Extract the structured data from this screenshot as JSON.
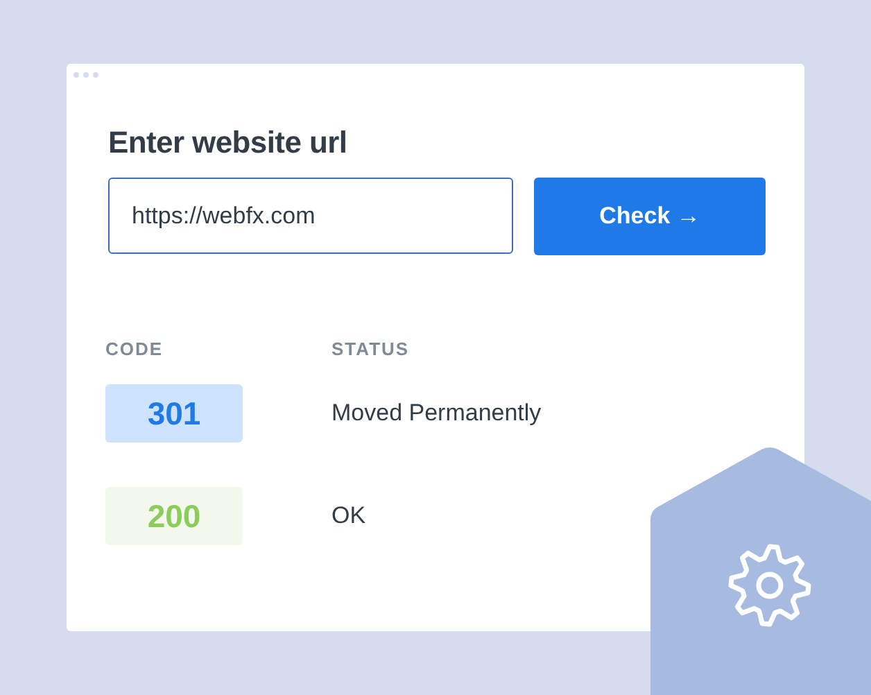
{
  "form": {
    "heading": "Enter website url",
    "url_value": "https://webfx.com",
    "button": "Check →"
  },
  "table": {
    "columns": [
      "CODE",
      "STATUS"
    ],
    "rows": [
      {
        "code": "301",
        "status": "Moved Permanently",
        "kind": "redirect"
      },
      {
        "code": "200",
        "status": "OK",
        "kind": "success"
      }
    ]
  }
}
